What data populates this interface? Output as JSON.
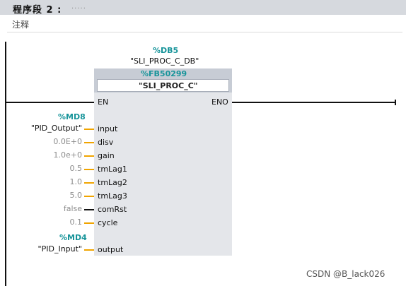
{
  "network": {
    "title": "程序段 2 :",
    "title_dots": ".....",
    "comment": "注释"
  },
  "instance_db": {
    "address": "%DB5",
    "symbol": "\"SLI_PROC_C_DB\""
  },
  "block": {
    "address": "%FB50299",
    "name": "\"SLI_PROC_C\"",
    "en": "EN",
    "eno": "ENO"
  },
  "inputs": [
    {
      "pin": "input",
      "address": "%MD8",
      "value": "\"PID_Output\"",
      "kind": "symbol"
    },
    {
      "pin": "disv",
      "value": "0.0E+0",
      "kind": "const"
    },
    {
      "pin": "gain",
      "value": "1.0e+0",
      "kind": "const"
    },
    {
      "pin": "tmLag1",
      "value": "0.5",
      "kind": "const"
    },
    {
      "pin": "tmLag2",
      "value": "1.0",
      "kind": "const"
    },
    {
      "pin": "tmLag3",
      "value": "5.0",
      "kind": "const"
    },
    {
      "pin": "comRst",
      "value": "false",
      "kind": "bool"
    },
    {
      "pin": "cycle",
      "value": "0.1",
      "kind": "const"
    }
  ],
  "outputs": [
    {
      "pin": "output",
      "address": "%MD4",
      "value": "\"PID_Input\"",
      "kind": "symbol"
    }
  ],
  "colors": {
    "address": "#17949a",
    "real_wire": "#f0a400",
    "bool_wire": "#111111",
    "block": "#e4e6ea",
    "header": "#d6d9de"
  },
  "watermark": "CSDN @B_lack026"
}
